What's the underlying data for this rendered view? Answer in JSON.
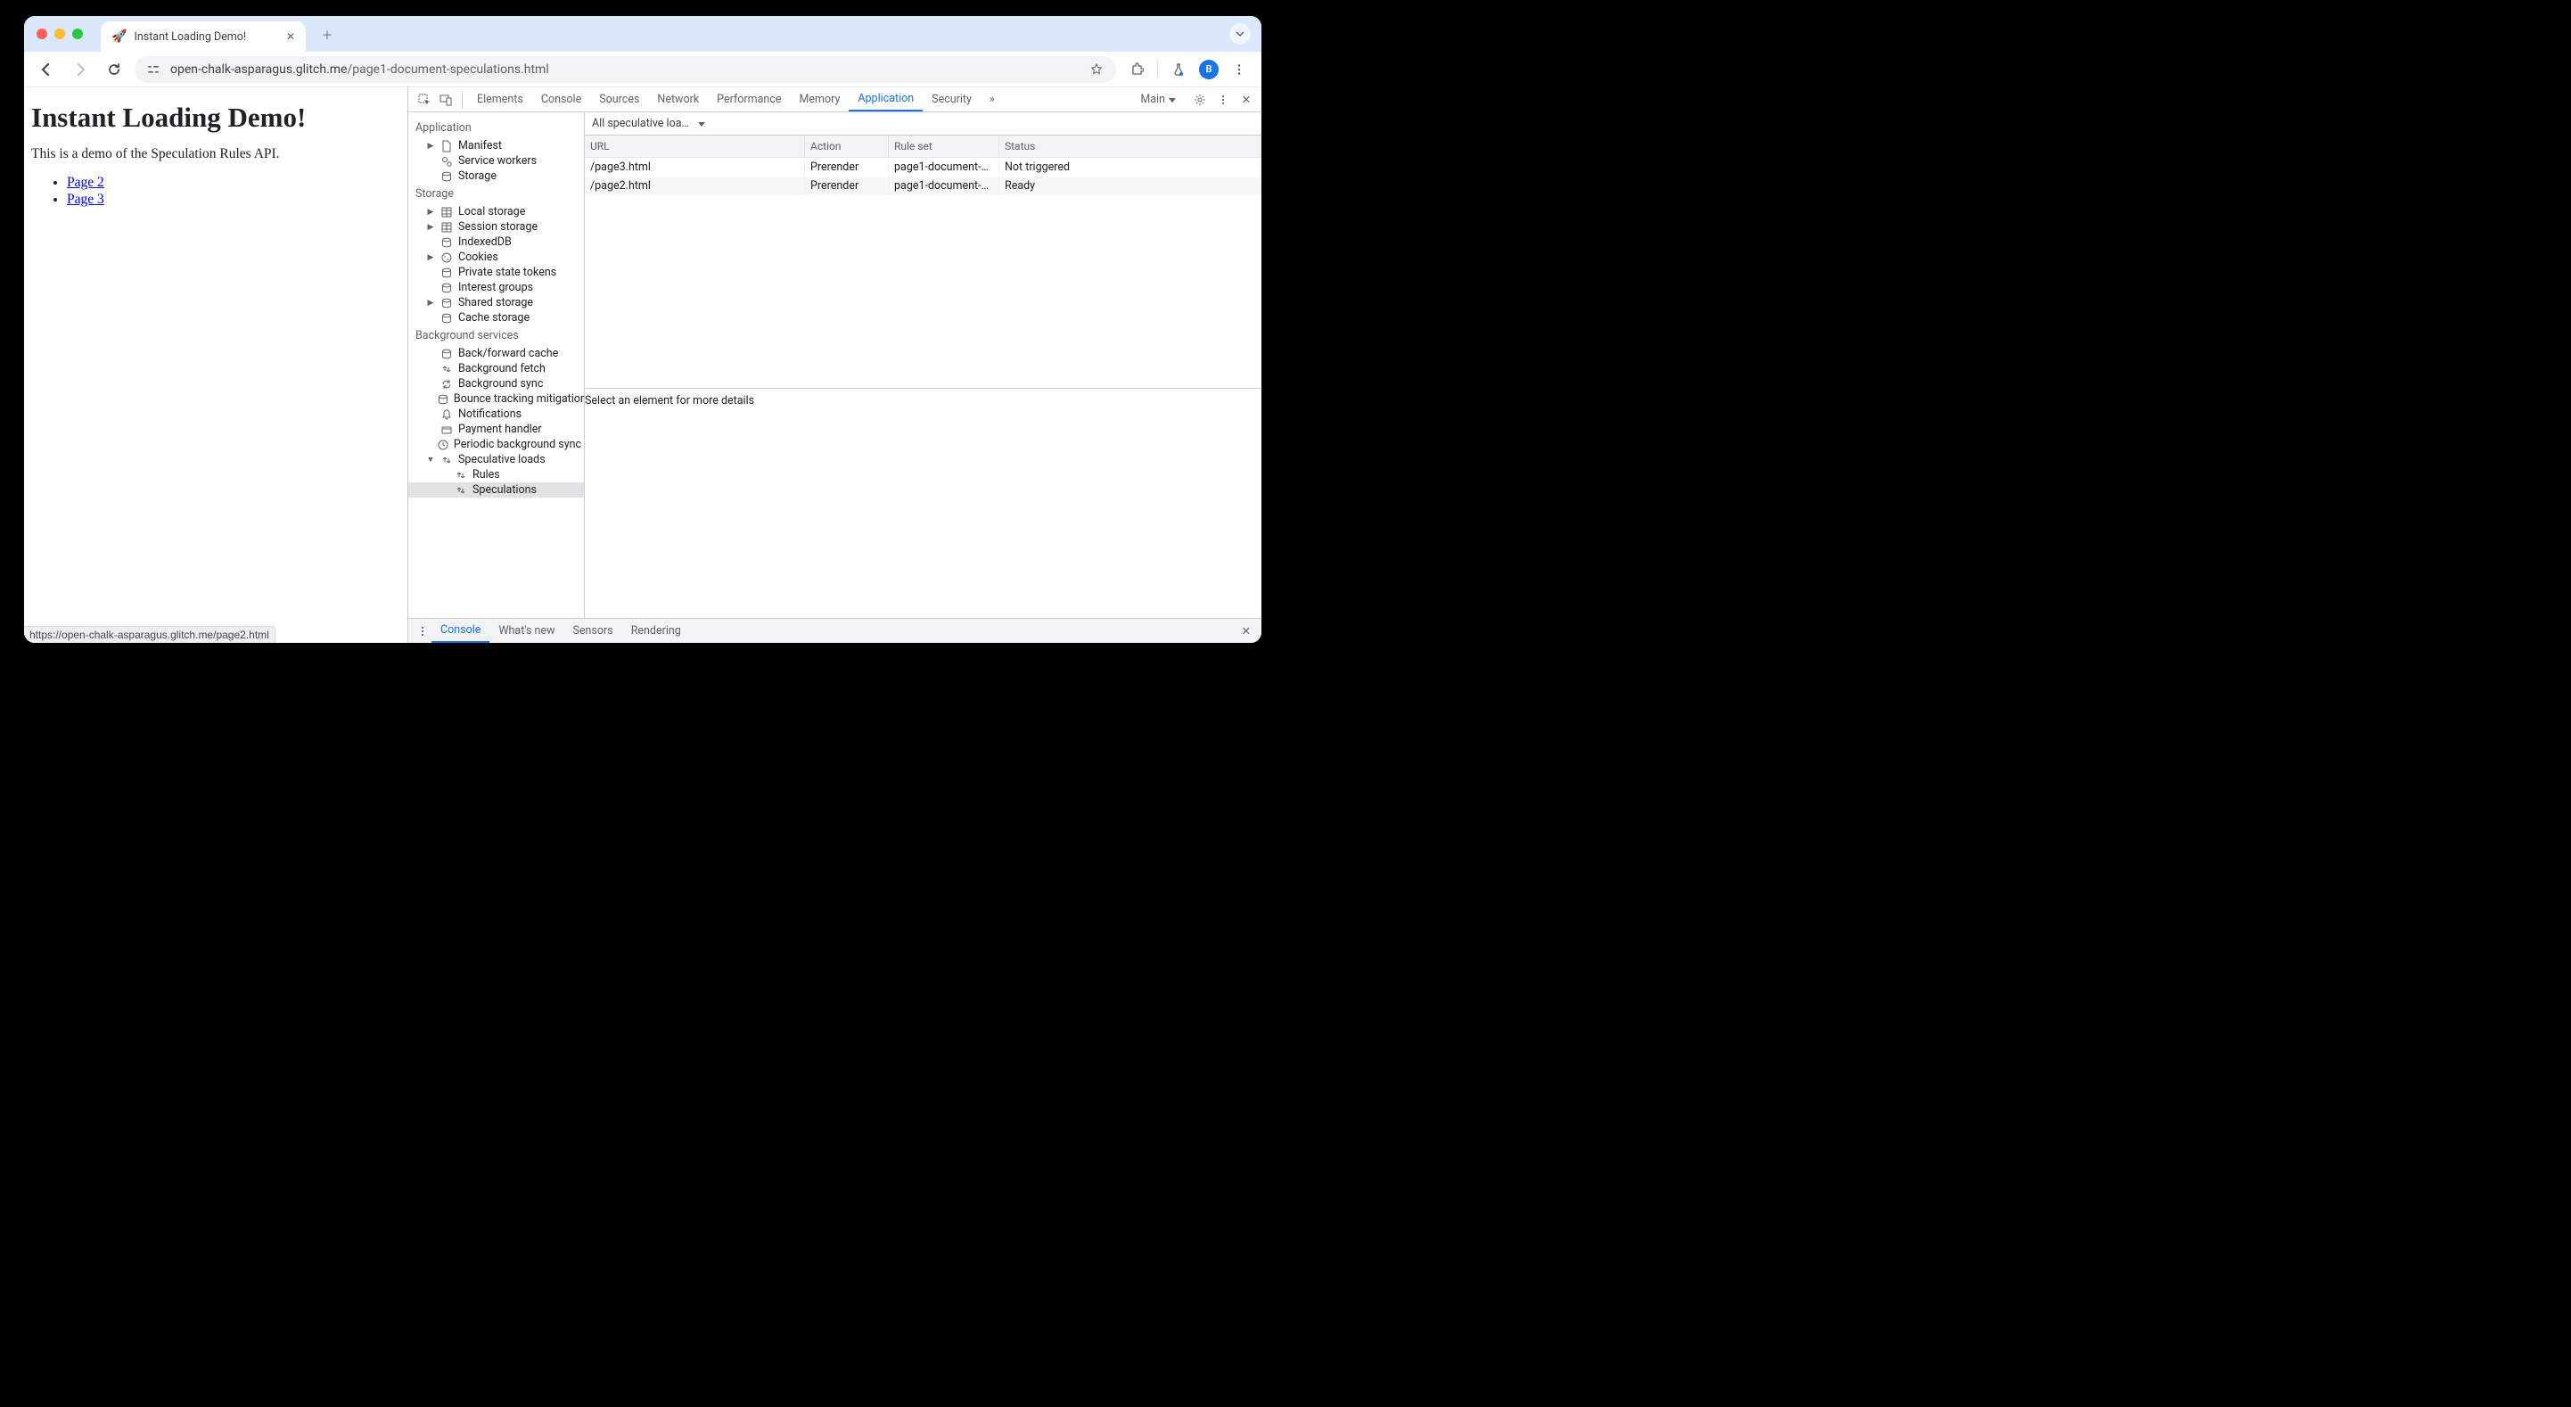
{
  "browser": {
    "tab_title": "Instant Loading Demo!",
    "favicon": "🚀",
    "url_host": "open-chalk-asparagus.glitch.me",
    "url_path": "/page1-document-speculations.html",
    "avatar_letter": "B",
    "status_url": "https://open-chalk-asparagus.glitch.me/page2.html"
  },
  "page": {
    "heading": "Instant Loading Demo!",
    "intro": "This is a demo of the Speculation Rules API.",
    "links": [
      "Page 2",
      "Page 3"
    ]
  },
  "devtools": {
    "tabs": [
      "Elements",
      "Console",
      "Sources",
      "Network",
      "Performance",
      "Memory",
      "Application",
      "Security"
    ],
    "active_tab": "Application",
    "target_label": "Main",
    "sidebar": {
      "groups": [
        {
          "title": "Application",
          "items": [
            {
              "label": "Manifest",
              "icon": "file",
              "caret": "▶"
            },
            {
              "label": "Service workers",
              "icon": "gears"
            },
            {
              "label": "Storage",
              "icon": "db"
            }
          ]
        },
        {
          "title": "Storage",
          "items": [
            {
              "label": "Local storage",
              "icon": "grid",
              "caret": "▶"
            },
            {
              "label": "Session storage",
              "icon": "grid",
              "caret": "▶"
            },
            {
              "label": "IndexedDB",
              "icon": "db"
            },
            {
              "label": "Cookies",
              "icon": "cookie",
              "caret": "▶"
            },
            {
              "label": "Private state tokens",
              "icon": "db"
            },
            {
              "label": "Interest groups",
              "icon": "db"
            },
            {
              "label": "Shared storage",
              "icon": "db",
              "caret": "▶"
            },
            {
              "label": "Cache storage",
              "icon": "db"
            }
          ]
        },
        {
          "title": "Background services",
          "items": [
            {
              "label": "Back/forward cache",
              "icon": "db"
            },
            {
              "label": "Background fetch",
              "icon": "updown"
            },
            {
              "label": "Background sync",
              "icon": "sync"
            },
            {
              "label": "Bounce tracking mitigation",
              "icon": "db"
            },
            {
              "label": "Notifications",
              "icon": "bell"
            },
            {
              "label": "Payment handler",
              "icon": "card"
            },
            {
              "label": "Periodic background sync",
              "icon": "clock"
            },
            {
              "label": "Speculative loads",
              "icon": "updown",
              "caret": "▼",
              "children": [
                {
                  "label": "Rules",
                  "icon": "updown"
                },
                {
                  "label": "Speculations",
                  "icon": "updown",
                  "selected": true
                }
              ]
            }
          ]
        }
      ]
    },
    "filter_label": "All speculative loa…",
    "columns": [
      "URL",
      "Action",
      "Rule set",
      "Status"
    ],
    "rows": [
      {
        "url": "/page3.html",
        "action": "Prerender",
        "ruleset": "page1-document-…",
        "status": "Not triggered"
      },
      {
        "url": "/page2.html",
        "action": "Prerender",
        "ruleset": "page1-document-…",
        "status": "Ready"
      }
    ],
    "detail_hint": "Select an element for more details",
    "drawer_tabs": [
      "Console",
      "What's new",
      "Sensors",
      "Rendering"
    ],
    "drawer_active": "Console"
  }
}
